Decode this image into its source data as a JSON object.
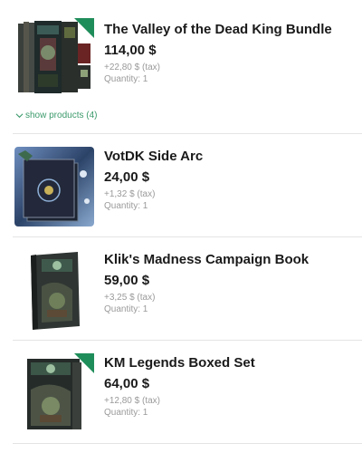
{
  "items": [
    {
      "title": "The Valley of the Dead King Bundle",
      "price": "114,00 $",
      "tax": "+22,80 $ (tax)",
      "quantity": "Quantity: 1",
      "show_products": "show products (4)"
    },
    {
      "title": "VotDK Side Arc",
      "price": "24,00 $",
      "tax": "+1,32 $ (tax)",
      "quantity": "Quantity: 1"
    },
    {
      "title": "Klik's Madness Campaign Book",
      "price": "59,00 $",
      "tax": "+3,25 $ (tax)",
      "quantity": "Quantity: 1"
    },
    {
      "title": "KM Legends Boxed Set",
      "price": "64,00 $",
      "tax": "+12,80 $ (tax)",
      "quantity": "Quantity: 1"
    }
  ],
  "colors": {
    "accent_green": "#3b9a6b",
    "ribbon_green": "#1f8d5a",
    "muted_text": "#9a9a9a"
  }
}
